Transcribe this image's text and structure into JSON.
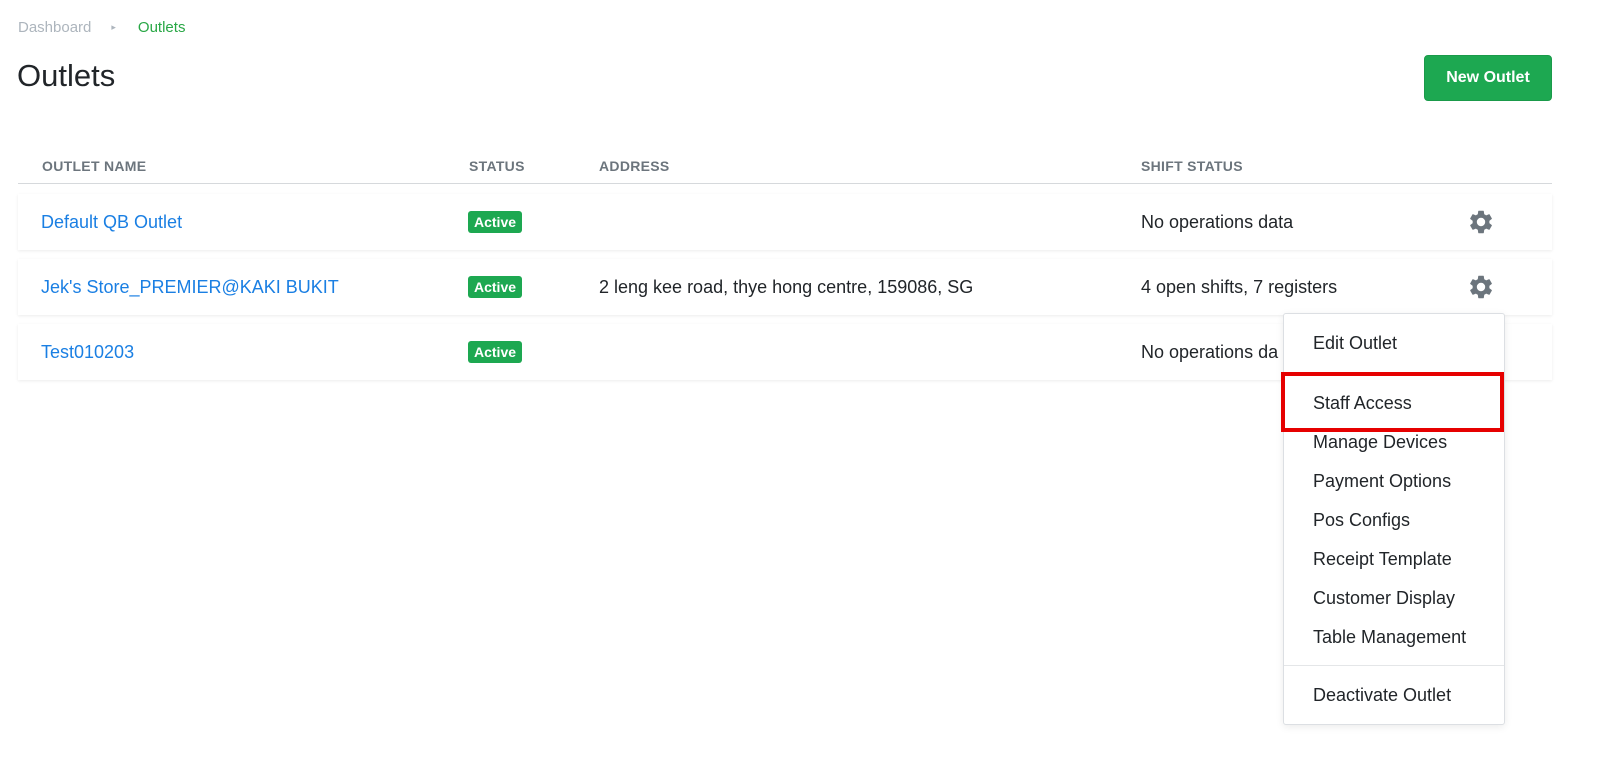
{
  "breadcrumb": {
    "home": "Dashboard",
    "separator": "▸",
    "current": "Outlets"
  },
  "page": {
    "title": "Outlets",
    "new_button": "New Outlet"
  },
  "table": {
    "headers": {
      "name": "OUTLET NAME",
      "status": "STATUS",
      "address": "ADDRESS",
      "shift": "SHIFT STATUS"
    },
    "rows": [
      {
        "name": "Default QB Outlet",
        "status": "Active",
        "address": "",
        "shift": "No operations data"
      },
      {
        "name": "Jek's Store_PREMIER@KAKI BUKIT",
        "status": "Active",
        "address": "2 leng kee road, thye hong centre, 159086, SG",
        "shift": "4 open shifts, 7 registers"
      },
      {
        "name": "Test010203",
        "status": "Active",
        "address": "",
        "shift": "No operations da"
      }
    ]
  },
  "menu": {
    "items": [
      "Edit Outlet",
      "Staff Access",
      "Manage Devices",
      "Payment Options",
      "Pos Configs",
      "Receipt Template",
      "Customer Display",
      "Table Management",
      "Deactivate Outlet"
    ]
  },
  "colors": {
    "accent": "#1da851",
    "link": "#1a7fe3",
    "highlight": "#e60000",
    "muted": "#adb5bd",
    "gear": "#6c757d"
  },
  "icons": {
    "row_action": "gear-icon"
  }
}
